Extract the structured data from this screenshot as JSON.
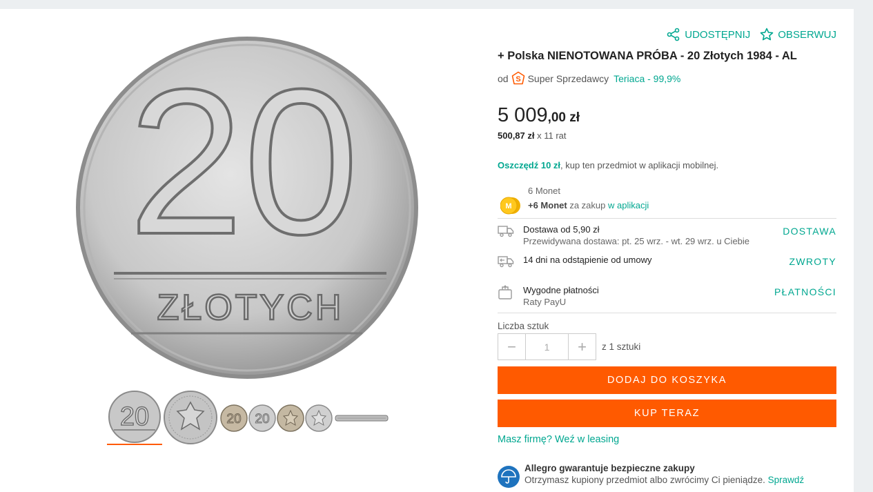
{
  "product": {
    "title": "+ Polska NIENOTOWANA PRÓBA - 20 Złotych 1984 - AL",
    "share_label": "UDOSTĘPNIJ",
    "watch_label": "OBSERWUJ",
    "seller_prefix": "od",
    "seller_badge_text": "Super Sprzedawcy",
    "seller_badge_glyph": "S",
    "seller_name": "Teriaca - 99,9%",
    "price_int": "5 009",
    "price_dec": ",00 zł",
    "installment_amount": "500,87 zł",
    "installment_rest": " x 11 rat",
    "save_bold": "Oszczędź 10 zł",
    "save_rest": ", kup ten przedmiot w aplikacji mobilnej.",
    "coins_label": "6 Monet",
    "coins_bonus": "+6 Monet",
    "coins_middle": " za zakup ",
    "coins_link": "w aplikacji",
    "coin_logo_letter": "M",
    "coin_number": "20",
    "coin_word": "ZŁOTYCH"
  },
  "delivery": {
    "title": "Dostawa od 5,90 zł",
    "subtitle": "Przewidywana dostawa: pt. 25 wrz. - wt. 29 wrz. u Ciebie",
    "link": "DOSTAWA"
  },
  "returns": {
    "title": "14 dni na odstąpienie od umowy",
    "link": "ZWROTY"
  },
  "payments": {
    "title": "Wygodne płatności",
    "subtitle": "Raty PayU",
    "link": "PŁATNOŚCI"
  },
  "quantity": {
    "label": "Liczba sztuk",
    "minus": "−",
    "value": "1",
    "plus": "+",
    "of_text": "z 1 sztuki"
  },
  "buttons": {
    "add_to_cart": "DODAJ DO KOSZYKA",
    "buy_now": "KUP TERAZ"
  },
  "leasing_link": "Masz firmę? Weź w leasing",
  "guarantee": {
    "title": "Allegro gwarantuje bezpieczne zakupy",
    "text": "Otrzymasz kupiony przedmiot albo zwrócimy Ci pieniądze. ",
    "link": "Sprawdź"
  },
  "colors": {
    "accent": "#00a790",
    "cta": "#ff5a00"
  }
}
